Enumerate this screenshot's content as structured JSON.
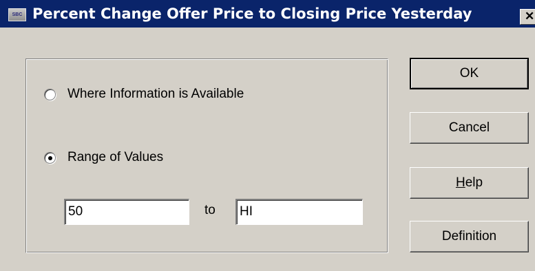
{
  "window": {
    "icon_text": "SBC",
    "title": "Percent Change Offer Price to Closing Price Yesterday",
    "close_glyph": "✕"
  },
  "options": {
    "where_available": {
      "label": "Where Information is Available",
      "selected": false
    },
    "range_of_values": {
      "label": "Range of Values",
      "selected": true
    }
  },
  "range": {
    "from_value": "50",
    "to_label": "to",
    "to_value": "HI"
  },
  "buttons": {
    "ok": "OK",
    "cancel": "Cancel",
    "help_mnemonic": "H",
    "help_rest": "elp",
    "definition": "Definition"
  },
  "icons": {
    "app": "sbc-app-icon",
    "close": "close-icon"
  }
}
